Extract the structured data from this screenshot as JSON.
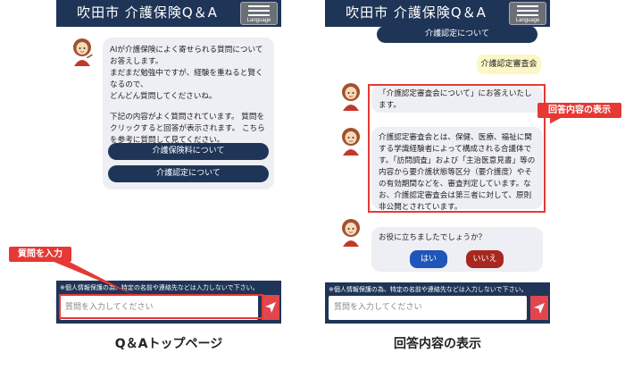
{
  "app": {
    "title": "吹田市 介護保険Q＆A",
    "language_label": "Language",
    "footer_note": "※個人情報保護の為、特定の名前や連絡先などは入力しないで下さい。",
    "input_placeholder": "質問を入力してください"
  },
  "top_page": {
    "intro_lines": [
      "AIが介護保険によく寄せられる質問についてお答えします。",
      "まだまだ勉強中ですが、経験を重ねると賢くなるので、",
      "どんどん質問してくださいね。"
    ],
    "hint_text": "下記の内容がよく質問されています。 質問をクリックすると回答が表示されます。 こちらを参考に質問して見てください。",
    "faq_buttons": [
      "介護保険料について",
      "介護認定について"
    ]
  },
  "answer_page": {
    "prev_button": "介護認定について",
    "user_message": "介護認定審査会",
    "bot_reply_intro": "「介護認定審査会について」にお答えいたします。",
    "bot_answer": "介護認定審査会とは、保健、医療、福祉に関する学識経験者によって構成される合議体です。「訪問調査」および「主治医意見書」等の内容から要介護状態等区分（要介護度）やその有効期間などを、審査判定しています。なお、介護認定審査会は第三者に対して、原則非公開とされています。",
    "feedback_question": "お役に立ちましたでしょうか？",
    "yes_label": "はい",
    "no_label": "いいえ"
  },
  "annotations": {
    "input_callout": "質問を入力",
    "answer_callout": "回答内容の表示"
  },
  "captions": {
    "left": "Q＆Aトップページ",
    "right": "回答内容の表示"
  },
  "colors": {
    "header_navy": "#1f3557",
    "accent_red": "#e53935",
    "send_button": "#e2454d",
    "bubble_gray": "#eeeff4",
    "user_bubble": "#fdf6c6",
    "yes_blue": "#1f56b8",
    "no_red": "#a8281f"
  },
  "icons": [
    "hamburger-menu-icon",
    "send-icon",
    "assistant-avatar-icon"
  ]
}
